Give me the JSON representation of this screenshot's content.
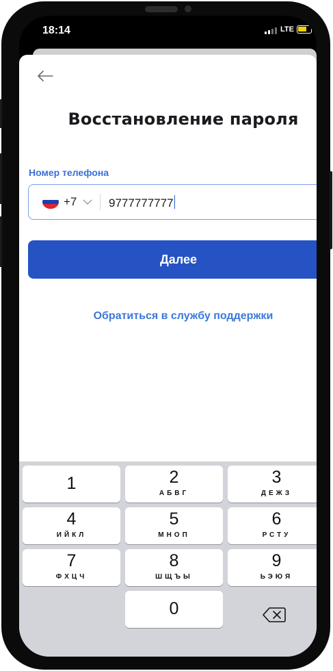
{
  "status_bar": {
    "time": "18:14",
    "network": "LTE"
  },
  "header": {
    "title": "Восстановление пароля"
  },
  "form": {
    "phone_label": "Номер телефона",
    "country_code": "+7",
    "phone_value": "9777777777",
    "next_button": "Далее"
  },
  "support_link": "Обратиться в службу поддержки",
  "keyboard": {
    "keys": [
      {
        "digit": "1",
        "letters": ""
      },
      {
        "digit": "2",
        "letters": "АБВГ"
      },
      {
        "digit": "3",
        "letters": "ДЕЖЗ"
      },
      {
        "digit": "4",
        "letters": "ИЙКЛ"
      },
      {
        "digit": "5",
        "letters": "МНОП"
      },
      {
        "digit": "6",
        "letters": "РСТУ"
      },
      {
        "digit": "7",
        "letters": "ФХЦЧ"
      },
      {
        "digit": "8",
        "letters": "ШЩЪЫ"
      },
      {
        "digit": "9",
        "letters": "ЬЭЮЯ"
      },
      {
        "digit": "0",
        "letters": ""
      }
    ]
  },
  "colors": {
    "accent": "#2653c3",
    "link": "#3c78d8",
    "battery": "#f2d400"
  }
}
